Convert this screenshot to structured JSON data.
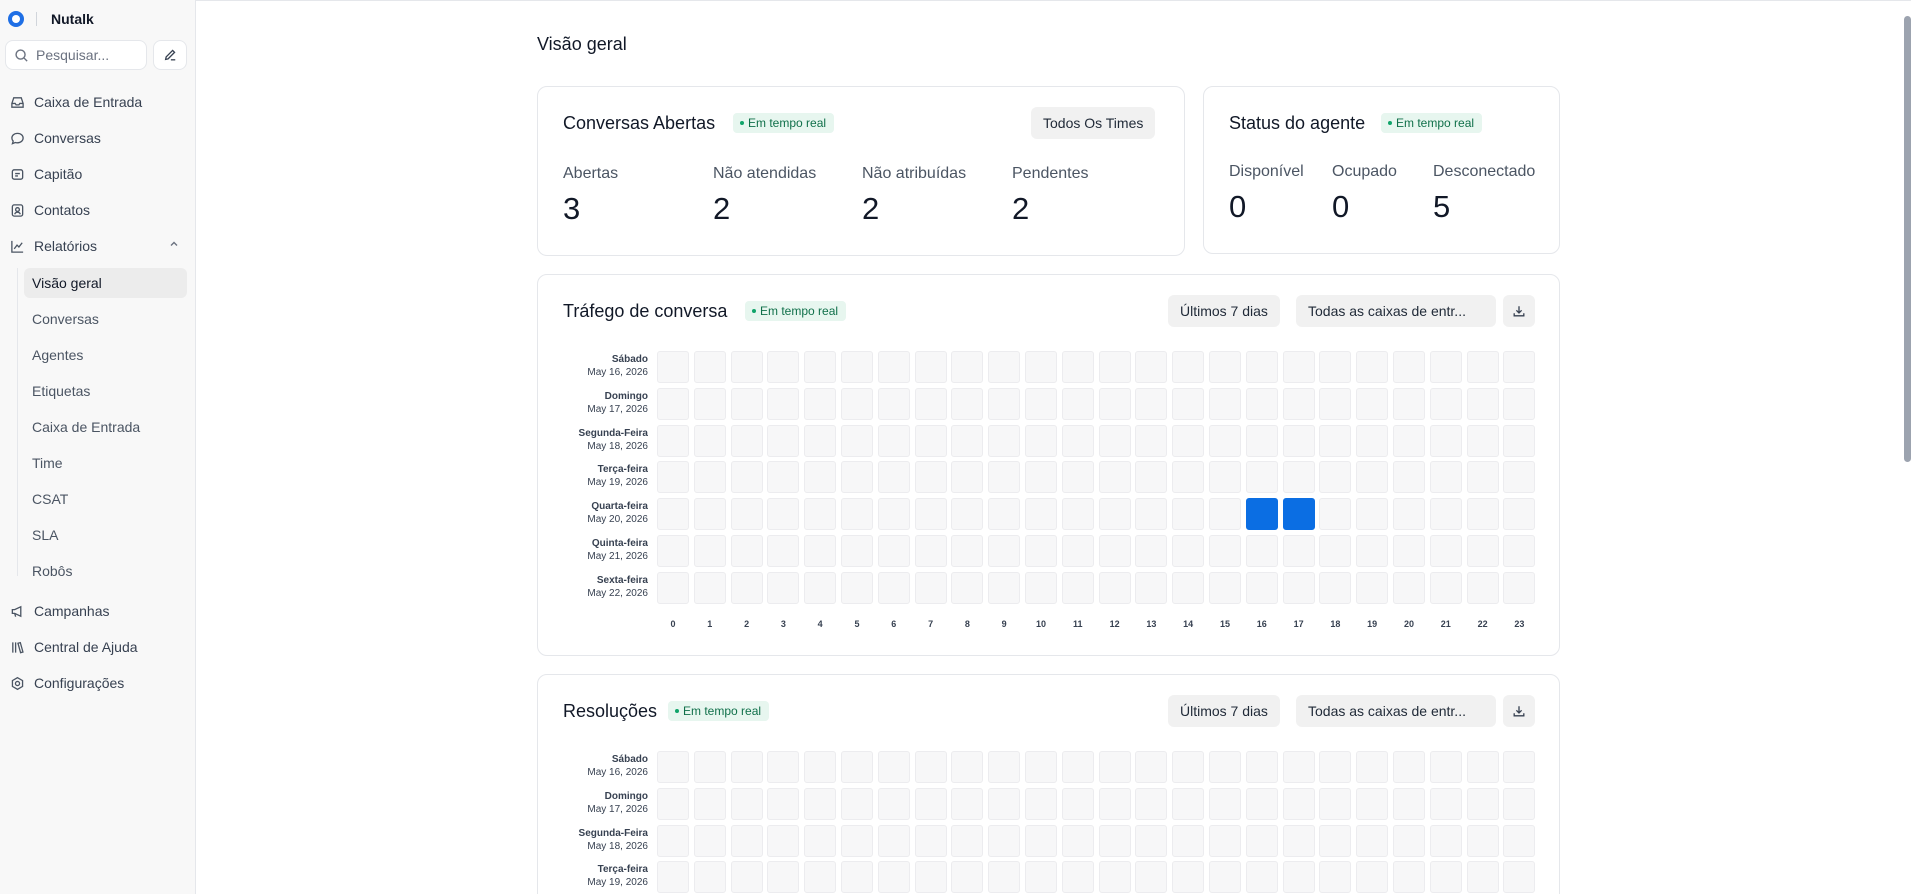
{
  "app": {
    "brand": "Nutalk"
  },
  "search": {
    "placeholder": "Pesquisar..."
  },
  "nav": {
    "inbox": "Caixa de Entrada",
    "conversations": "Conversas",
    "captain": "Capitão",
    "contacts": "Contatos",
    "reports": "Relatórios",
    "campaigns": "Campanhas",
    "help_center": "Central de Ajuda",
    "settings": "Configurações"
  },
  "reports_menu": [
    {
      "label": "Visão geral",
      "active": true
    },
    {
      "label": "Conversas"
    },
    {
      "label": "Agentes"
    },
    {
      "label": "Etiquetas"
    },
    {
      "label": "Caixa de Entrada"
    },
    {
      "label": "Time"
    },
    {
      "label": "CSAT"
    },
    {
      "label": "SLA"
    },
    {
      "label": "Robôs"
    }
  ],
  "page": {
    "title": "Visão geral"
  },
  "open_conversations": {
    "title": "Conversas Abertas",
    "badge": "Em tempo real",
    "filter": "Todos Os Times",
    "metrics": [
      {
        "label": "Abertas",
        "value": "3"
      },
      {
        "label": "Não atendidas",
        "value": "2"
      },
      {
        "label": "Não atribuídas",
        "value": "2"
      },
      {
        "label": "Pendentes",
        "value": "2"
      }
    ]
  },
  "agent_status": {
    "title": "Status do agente",
    "badge": "Em tempo real",
    "metrics": [
      {
        "label": "Disponível",
        "value": "0"
      },
      {
        "label": "Ocupado",
        "value": "0"
      },
      {
        "label": "Desconectado",
        "value": "5"
      }
    ]
  },
  "traffic": {
    "title": "Tráfego de conversa",
    "badge": "Em tempo real",
    "range": "Últimos 7 dias",
    "inbox_filter": "Todas as caixas de entr...",
    "download_icon": "download-icon",
    "days": [
      {
        "name": "Sábado",
        "date": "May 16, 2026"
      },
      {
        "name": "Domingo",
        "date": "May 17, 2026"
      },
      {
        "name": "Segunda-Feira",
        "date": "May 18, 2026"
      },
      {
        "name": "Terça-feira",
        "date": "May 19, 2026"
      },
      {
        "name": "Quarta-feira",
        "date": "May 20, 2026"
      },
      {
        "name": "Quinta-feira",
        "date": "May 21, 2026"
      },
      {
        "name": "Sexta-feira",
        "date": "May 22, 2026"
      }
    ],
    "hours": [
      "0",
      "1",
      "2",
      "3",
      "4",
      "5",
      "6",
      "7",
      "8",
      "9",
      "10",
      "11",
      "12",
      "13",
      "14",
      "15",
      "16",
      "17",
      "18",
      "19",
      "20",
      "21",
      "22",
      "23"
    ],
    "active_cells": [
      {
        "day": 4,
        "hour": 16
      },
      {
        "day": 4,
        "hour": 17
      }
    ],
    "active_color": "#0b6ee3"
  },
  "resolutions": {
    "title": "Resoluções",
    "badge": "Em tempo real",
    "range": "Últimos 7 dias",
    "inbox_filter": "Todas as caixas de entr...",
    "download_icon": "download-icon",
    "days": [
      {
        "name": "Sábado",
        "date": "May 16, 2026"
      },
      {
        "name": "Domingo",
        "date": "May 17, 2026"
      },
      {
        "name": "Segunda-Feira",
        "date": "May 18, 2026"
      },
      {
        "name": "Terça-feira",
        "date": "May 19, 2026"
      }
    ]
  }
}
